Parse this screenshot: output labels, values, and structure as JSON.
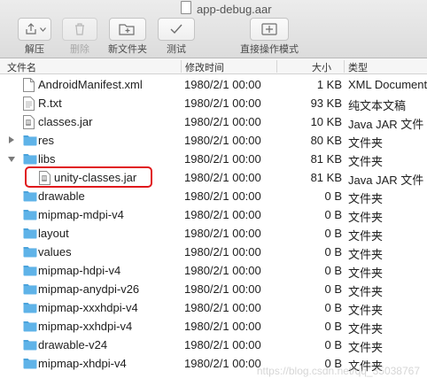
{
  "window": {
    "title": "app-debug.aar"
  },
  "toolbar": {
    "extract_label": "解压",
    "delete_label": "删除",
    "new_folder_label": "新文件夹",
    "test_label": "测试",
    "direct_mode_label": "直接操作模式"
  },
  "columns": {
    "name": "文件名",
    "modified": "修改时间",
    "size": "大小",
    "kind": "类型"
  },
  "files": [
    {
      "name": "AndroidManifest.xml",
      "modified": "1980/2/1 00:00",
      "size": "1 KB",
      "kind": "XML Document",
      "icon": "document-icon",
      "level": 0,
      "disclosure": ""
    },
    {
      "name": "R.txt",
      "modified": "1980/2/1 00:00",
      "size": "93 KB",
      "kind": "纯文本文稿",
      "icon": "text-document-icon",
      "level": 0,
      "disclosure": ""
    },
    {
      "name": "classes.jar",
      "modified": "1980/2/1 00:00",
      "size": "10 KB",
      "kind": "Java JAR 文件",
      "icon": "jar-icon",
      "level": 0,
      "disclosure": ""
    },
    {
      "name": "res",
      "modified": "1980/2/1 00:00",
      "size": "80 KB",
      "kind": "文件夹",
      "icon": "folder-icon",
      "level": 0,
      "disclosure": "closed"
    },
    {
      "name": "libs",
      "modified": "1980/2/1 00:00",
      "size": "81 KB",
      "kind": "文件夹",
      "icon": "folder-icon",
      "level": 0,
      "disclosure": "open"
    },
    {
      "name": "unity-classes.jar",
      "modified": "1980/2/1 00:00",
      "size": "81 KB",
      "kind": "Java JAR 文件",
      "icon": "jar-icon",
      "level": 1,
      "disclosure": ""
    },
    {
      "name": "drawable",
      "modified": "1980/2/1 00:00",
      "size": "0 B",
      "kind": "文件夹",
      "icon": "folder-icon",
      "level": 0,
      "disclosure": ""
    },
    {
      "name": "mipmap-mdpi-v4",
      "modified": "1980/2/1 00:00",
      "size": "0 B",
      "kind": "文件夹",
      "icon": "folder-icon",
      "level": 0,
      "disclosure": ""
    },
    {
      "name": "layout",
      "modified": "1980/2/1 00:00",
      "size": "0 B",
      "kind": "文件夹",
      "icon": "folder-icon",
      "level": 0,
      "disclosure": ""
    },
    {
      "name": "values",
      "modified": "1980/2/1 00:00",
      "size": "0 B",
      "kind": "文件夹",
      "icon": "folder-icon",
      "level": 0,
      "disclosure": ""
    },
    {
      "name": "mipmap-hdpi-v4",
      "modified": "1980/2/1 00:00",
      "size": "0 B",
      "kind": "文件夹",
      "icon": "folder-icon",
      "level": 0,
      "disclosure": ""
    },
    {
      "name": "mipmap-anydpi-v26",
      "modified": "1980/2/1 00:00",
      "size": "0 B",
      "kind": "文件夹",
      "icon": "folder-icon",
      "level": 0,
      "disclosure": ""
    },
    {
      "name": "mipmap-xxxhdpi-v4",
      "modified": "1980/2/1 00:00",
      "size": "0 B",
      "kind": "文件夹",
      "icon": "folder-icon",
      "level": 0,
      "disclosure": ""
    },
    {
      "name": "mipmap-xxhdpi-v4",
      "modified": "1980/2/1 00:00",
      "size": "0 B",
      "kind": "文件夹",
      "icon": "folder-icon",
      "level": 0,
      "disclosure": ""
    },
    {
      "name": "drawable-v24",
      "modified": "1980/2/1 00:00",
      "size": "0 B",
      "kind": "文件夹",
      "icon": "folder-icon",
      "level": 0,
      "disclosure": ""
    },
    {
      "name": "mipmap-xhdpi-v4",
      "modified": "1980/2/1 00:00",
      "size": "0 B",
      "kind": "文件夹",
      "icon": "folder-icon",
      "level": 0,
      "disclosure": ""
    }
  ],
  "highlight": {
    "target": "unity-classes.jar",
    "color": "#e0181c"
  },
  "watermark": "https://blog.csdn.net/qq_35038767",
  "colors": {
    "folder": "#5fb3e8",
    "folder_tab": "#4aa3dc"
  }
}
